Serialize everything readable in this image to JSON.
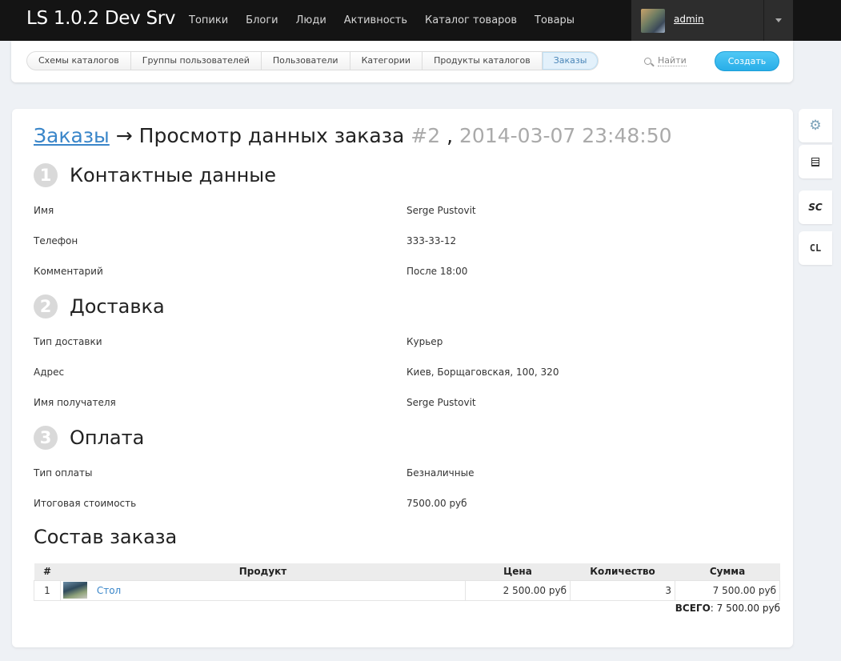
{
  "brand": "LS 1.0.2 Dev Srv",
  "nav": [
    "Топики",
    "Блоги",
    "Люди",
    "Активность",
    "Каталог товаров",
    "Товары"
  ],
  "user": {
    "name": "admin"
  },
  "subnav": {
    "pills": [
      "Схемы каталогов",
      "Группы пользователей",
      "Пользователи",
      "Категории",
      "Продукты каталогов",
      "Заказы"
    ],
    "active": "Заказы",
    "search_label": "Найти",
    "create_label": "Создать"
  },
  "page": {
    "crumb": "Заказы",
    "arrow": "→",
    "title": "Просмотр данных заказа",
    "order_no": "#2",
    "sep": ",",
    "datetime": "2014-03-07 23:48:50"
  },
  "sections": [
    {
      "num": "1",
      "title": "Контактные данные",
      "rows": [
        {
          "k": "Имя",
          "v": "Serge Pustovit"
        },
        {
          "k": "Телефон",
          "v": "333-33-12"
        },
        {
          "k": "Комментарий",
          "v": "После 18:00"
        }
      ]
    },
    {
      "num": "2",
      "title": "Доставка",
      "rows": [
        {
          "k": "Тип доставки",
          "v": "Курьер"
        },
        {
          "k": "Адрес",
          "v": "Киев, Борщаговская, 100, 320"
        },
        {
          "k": "Имя получателя",
          "v": "Serge Pustovit"
        }
      ]
    },
    {
      "num": "3",
      "title": "Оплата",
      "rows": [
        {
          "k": "Тип оплаты",
          "v": "Безналичные"
        },
        {
          "k": "Итоговая стоимость",
          "v": "7500.00 руб"
        }
      ]
    }
  ],
  "order": {
    "title": "Состав заказа",
    "headers": [
      "#",
      "Продукт",
      "Цена",
      "Количество",
      "Сумма"
    ],
    "rows": [
      {
        "n": "1",
        "product": "Стол",
        "price": "2 500.00 руб",
        "qty": "3",
        "sum": "7 500.00 руб"
      }
    ],
    "total_label": "ВСЕГО",
    "total_value": "7 500.00 руб"
  },
  "tools": [
    {
      "icon": "gear-icon"
    },
    {
      "icon": "document-icon"
    },
    {
      "label": "SC"
    },
    {
      "label": "CL"
    }
  ]
}
